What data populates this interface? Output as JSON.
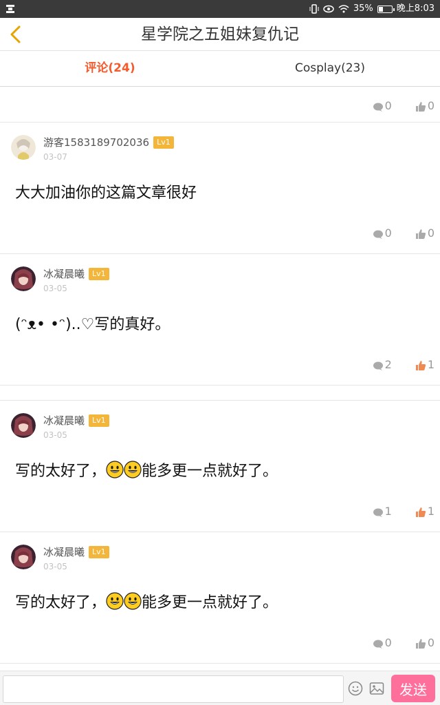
{
  "status": {
    "battery": "35%",
    "battery_level": 0.35,
    "time": "晚上8:03"
  },
  "header": {
    "title": "星学院之五姐妹复仇记",
    "back_icon": "chevron-left-icon"
  },
  "tabs": [
    {
      "label": "评论(24)",
      "active": true
    },
    {
      "label": "Cosplay(23)",
      "active": false
    }
  ],
  "top_actions": {
    "replies": "0",
    "likes": "0"
  },
  "comments": [
    {
      "user": "游客1583189702036",
      "level": "Lv1",
      "date": "03-07",
      "text": "大大加油你的这篇文章很好",
      "replies": "0",
      "likes": "0",
      "liked": false
    },
    {
      "user": "冰凝晨曦",
      "level": "Lv1",
      "date": "03-05",
      "text": "(ᵔᴥ•  •ᵔ)..♡写的真好。",
      "replies": "2",
      "likes": "1",
      "liked": true
    },
    {
      "user": "冰凝晨曦",
      "level": "Lv1",
      "date": "03-05",
      "text_before": "写的太好了，",
      "text_after": "能多更一点就好了。",
      "emoji_count": 2,
      "replies": "1",
      "likes": "1",
      "liked": true
    },
    {
      "user": "冰凝晨曦",
      "level": "Lv1",
      "date": "03-05",
      "text_before": "写的太好了，",
      "text_after": "能多更一点就好了。",
      "emoji_count": 2,
      "replies": "0",
      "likes": "0",
      "liked": false
    }
  ],
  "bottom": {
    "input_placeholder": "",
    "send_label": "发送"
  },
  "colors": {
    "accent": "#f25c2e",
    "badge": "#f3b63a",
    "send": "#ff6f9c",
    "liked": "#f08a55"
  }
}
